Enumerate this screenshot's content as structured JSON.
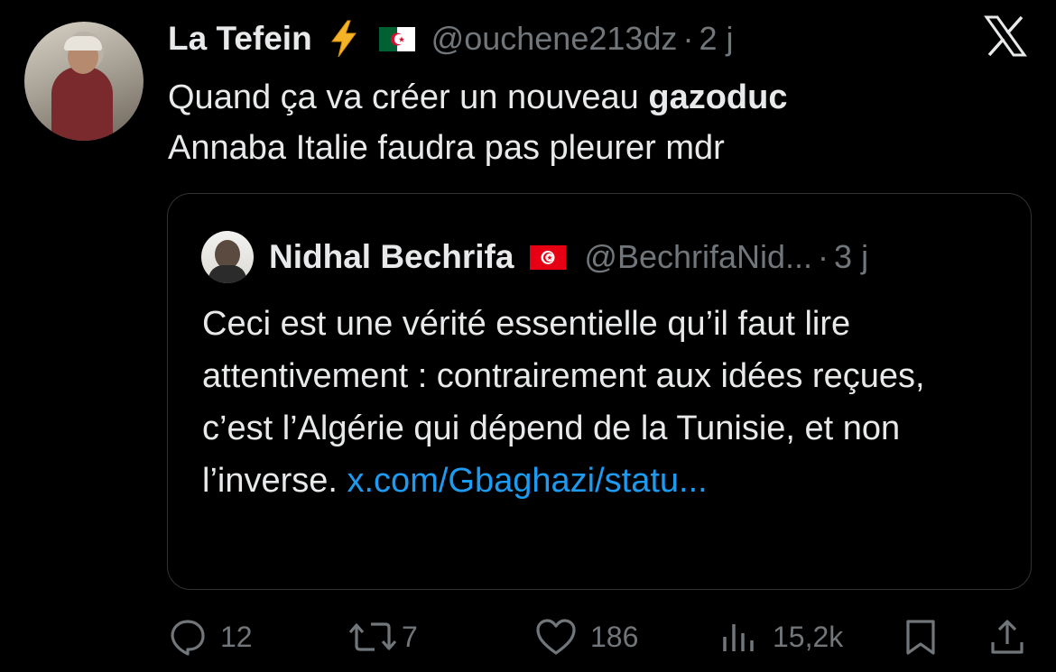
{
  "author": {
    "name": "La Tefein",
    "emoji_icon": "high-voltage-icon",
    "flag_icon": "algeria-flag-icon",
    "handle": "@ouchene213dz",
    "separator": "·",
    "time": "2 j"
  },
  "tweet": {
    "text_before": "Quand ça va créer un nouveau ",
    "text_bold": "gazoduc",
    "text_after": "Annaba Italie faudra pas pleurer mdr"
  },
  "quote": {
    "name": "Nidhal Bechrifa",
    "flag_icon": "tunisia-flag-icon",
    "handle": "@BechrifaNid...",
    "separator": "·",
    "time": "3 j",
    "text": "Ceci est une vérité essentielle qu’il faut lire attentivement : contrairement aux idées reçues, c’est l’Algérie qui dépend de la Tunisie, et non l’inverse. ",
    "link": "x.com/Gbaghazi/statu..."
  },
  "actions": {
    "replies": "12",
    "reposts": "7",
    "likes": "186",
    "views": "15,2k"
  },
  "colors": {
    "background": "#000000",
    "text": "#e7e9ea",
    "muted": "#71767b",
    "link": "#1d9bf0",
    "border": "#2f3336"
  }
}
